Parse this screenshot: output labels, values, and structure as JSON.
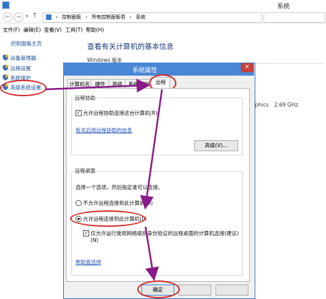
{
  "window": {
    "title": "系统"
  },
  "nav": {
    "back": "←",
    "forward": "→",
    "up": "↑",
    "address": [
      "控制面板",
      "所有控制面板项",
      "系统"
    ]
  },
  "menu": [
    "文件(F)",
    "编辑(E)",
    "查看(V)",
    "工具(T)",
    "帮助(H)"
  ],
  "sidebar": {
    "home": "控制面板主页",
    "items": [
      {
        "label": "设备管理器",
        "icon": "shield-icon"
      },
      {
        "label": "远程设置",
        "icon": "shield-icon"
      },
      {
        "label": "系统保护",
        "icon": "shield-icon"
      },
      {
        "label": "高级系统设置",
        "icon": "shield-icon"
      }
    ]
  },
  "main": {
    "heading": "查看有关计算机的基本信息",
    "windows_edition_label": "Windows 版本",
    "processor_fragment": "aphics",
    "processor_speed": "2.69 GHz"
  },
  "dialog": {
    "title": "系统属性",
    "close": "✕",
    "tabs": [
      "计算机名",
      "硬件",
      "高级",
      "系统保护",
      "远程"
    ],
    "active_tab": 4,
    "remote_assistance": {
      "group_label": "远程协助",
      "checkbox_label": "允许远程协助连接这台计算机(R)",
      "checkbox_checked": true,
      "help_link": "有关启用远程协助的信息",
      "advanced_button": "高级(V)..."
    },
    "remote_desktop": {
      "group_label": "远程桌面",
      "instruction": "选择一个选项，然后指定谁可以连接。",
      "option_deny": "不允许远程连接到此计算机(D)",
      "option_allow": "允许远程连接到此计算机(L)",
      "selected": "allow",
      "nla_label_line1": "仅允许运行使用网络级别身份验证的远程桌面的计算机连接(建议)",
      "nla_label_line2": "(N)",
      "nla_checked": true,
      "help_link": "帮助我选择"
    },
    "ok_button": "确定"
  },
  "colors": {
    "annotation": "#d42a2a",
    "arrow": "#8a1a8a",
    "dialog_title": "#4a86d6",
    "link": "#2256b8"
  }
}
